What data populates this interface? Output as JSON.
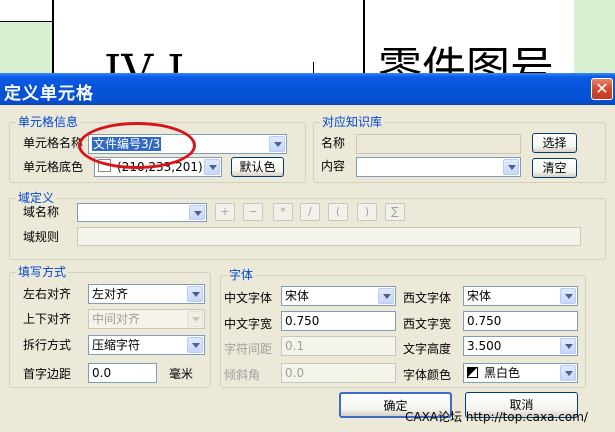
{
  "background": {
    "left_text": "IV I",
    "right_text": "零件图号"
  },
  "window": {
    "title": "定义单元格",
    "close_glyph": "✕"
  },
  "cell_info": {
    "group_label": "单元格信息",
    "name_label": "单元格名称",
    "name_value": "文件编号3/3",
    "color_label": "单元格底色",
    "color_value": "(210,233,201)",
    "default_color_button": "默认色"
  },
  "knowledge": {
    "group_label": "对应知识库",
    "name_label": "名称",
    "name_value": "",
    "select_button": "选择",
    "content_label": "内容",
    "content_value": "",
    "clear_button": "清空"
  },
  "domain": {
    "group_label": "域定义",
    "name_label": "域名称",
    "name_value": "",
    "ops": [
      "+",
      "−",
      "*",
      "/",
      "(",
      ")",
      "∑"
    ],
    "rule_label": "域规则",
    "rule_value": ""
  },
  "fill": {
    "group_label": "填写方式",
    "halign_label": "左右对齐",
    "halign_value": "左对齐",
    "valign_label": "上下对齐",
    "valign_value": "中间对齐",
    "wrap_label": "拆行方式",
    "wrap_value": "压缩字符",
    "margin_label": "首字边距",
    "margin_value": "0.0",
    "margin_unit": "毫米"
  },
  "font": {
    "group_label": "字体",
    "cn_font_label": "中文字体",
    "cn_font_value": "宋体",
    "en_font_label": "西文字体",
    "en_font_value": "宋体",
    "cn_width_label": "中文字宽",
    "cn_width_value": "0.750",
    "en_width_label": "西文字宽",
    "en_width_value": "0.750",
    "spacing_label": "字符间距",
    "spacing_value": "0.1",
    "height_label": "文字高度",
    "height_value": "3.500",
    "slant_label": "倾斜角",
    "slant_value": "0.0",
    "color_label": "字体颜色",
    "color_value": "黑白色"
  },
  "footer": {
    "ok_button": "确定",
    "cancel_button": "取消",
    "watermark": "CAXA论坛 http://top.caxa.com/"
  },
  "colors": {
    "title_bar": "#0653d9",
    "group_label": "#0046d5",
    "highlight_ellipse": "#d8141a",
    "background_cell": "#d9f0d3"
  }
}
